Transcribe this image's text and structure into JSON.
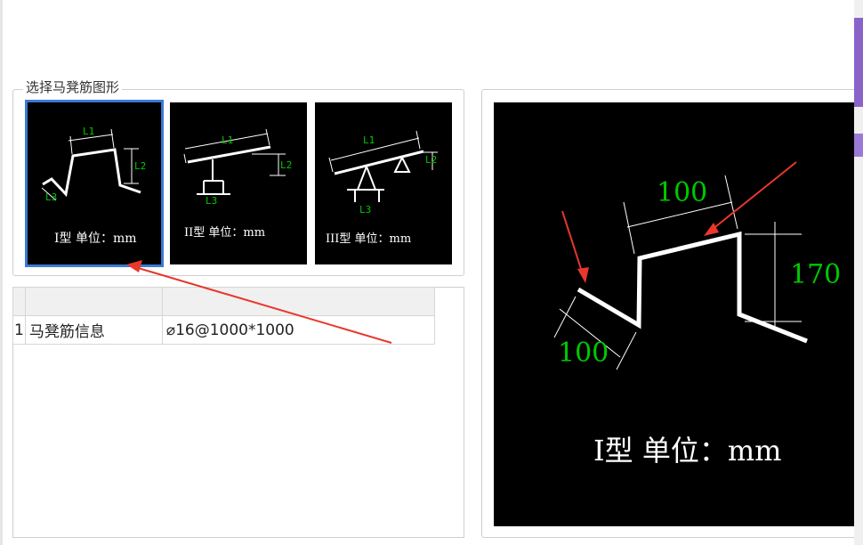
{
  "group": {
    "title": "选择马凳筋图形"
  },
  "shapes": [
    {
      "label": "I型 单位：mm",
      "dims": [
        "L1",
        "L2",
        "L3"
      ],
      "selected": true
    },
    {
      "label": "II型 单位：mm",
      "dims": [
        "L1",
        "L2",
        "L3"
      ],
      "selected": false
    },
    {
      "label": "III型 单位：mm",
      "dims": [
        "L1",
        "L2",
        "L3"
      ],
      "selected": false
    }
  ],
  "table": {
    "rows": [
      {
        "index": "1",
        "name": "马凳筋信息",
        "value": "⌀16@1000*1000"
      }
    ]
  },
  "preview": {
    "label": "I型 单位：mm",
    "dim_top": "100",
    "dim_right": "170",
    "dim_left": "100"
  },
  "colors": {
    "selection_border": "#3a7ad5",
    "dimension_text": "#00c800",
    "annotation_arrow": "#e8372b"
  }
}
